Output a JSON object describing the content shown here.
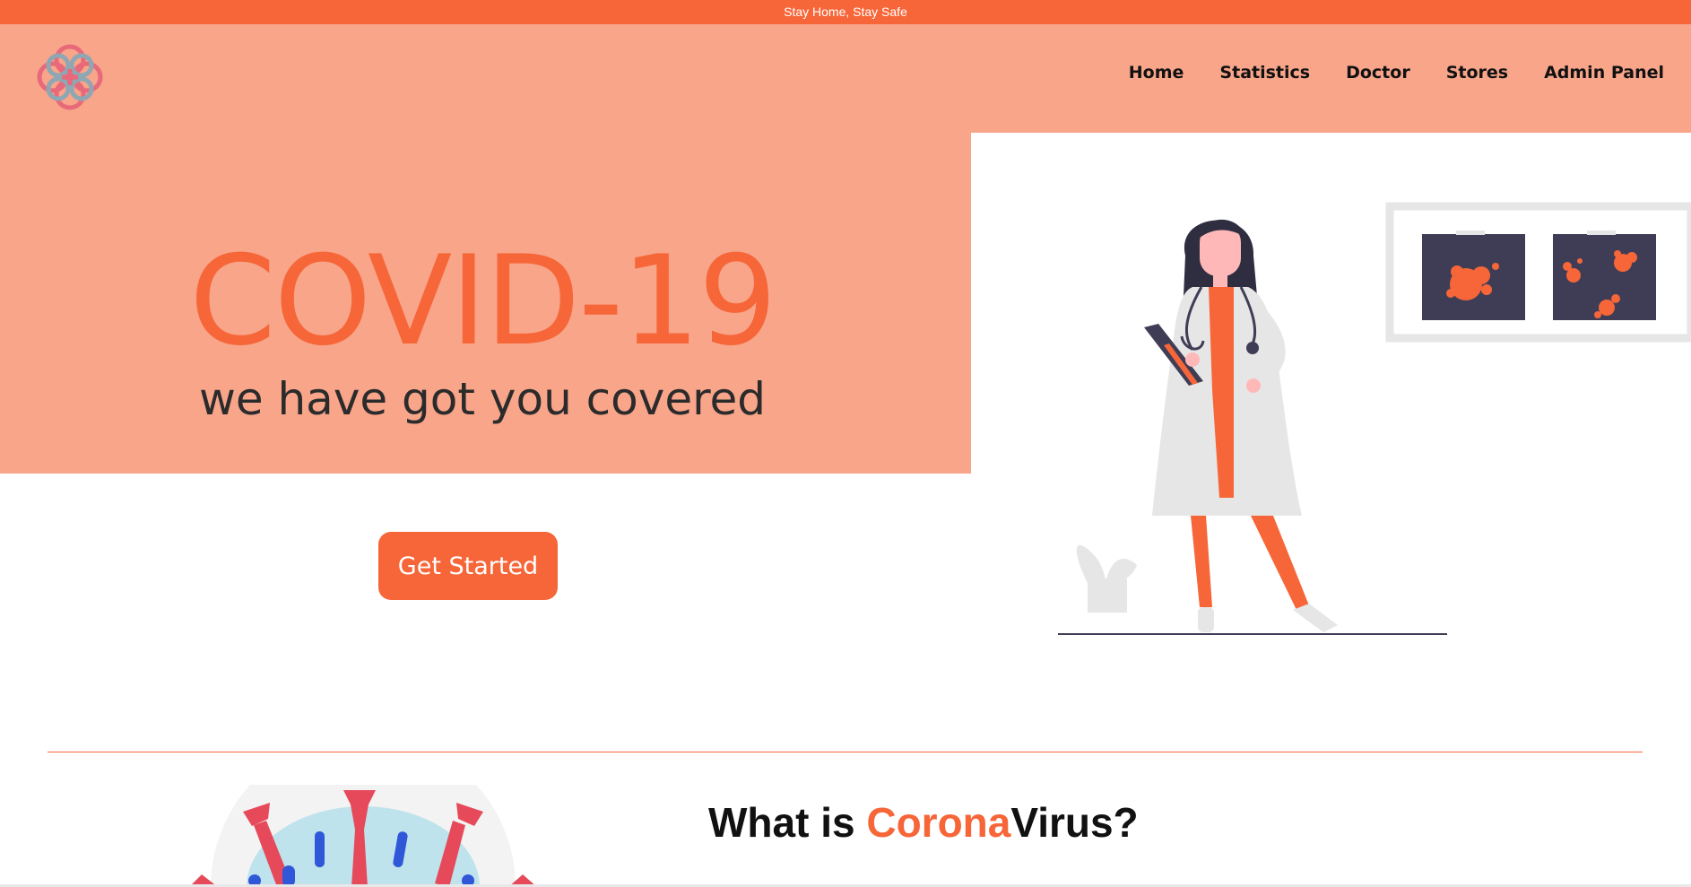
{
  "banner": {
    "text": "Stay Home, Stay Safe"
  },
  "logo": {
    "icon": "medical-knot-logo"
  },
  "nav": {
    "items": [
      {
        "label": "Home"
      },
      {
        "label": "Statistics"
      },
      {
        "label": "Doctor"
      },
      {
        "label": "Stores"
      },
      {
        "label": "Admin Panel"
      }
    ]
  },
  "hero": {
    "title": "COVID-19",
    "subtitle": "we have got you covered",
    "cta_label": "Get Started",
    "illustration": "doctor-with-xray-illustration"
  },
  "section": {
    "title_prefix": "What is ",
    "title_accent": "Corona",
    "title_suffix": "Virus?",
    "illustration": "virus-illustration"
  },
  "colors": {
    "accent": "#f66638",
    "salmon": "#f8a58a",
    "dark": "#3f3d56"
  }
}
